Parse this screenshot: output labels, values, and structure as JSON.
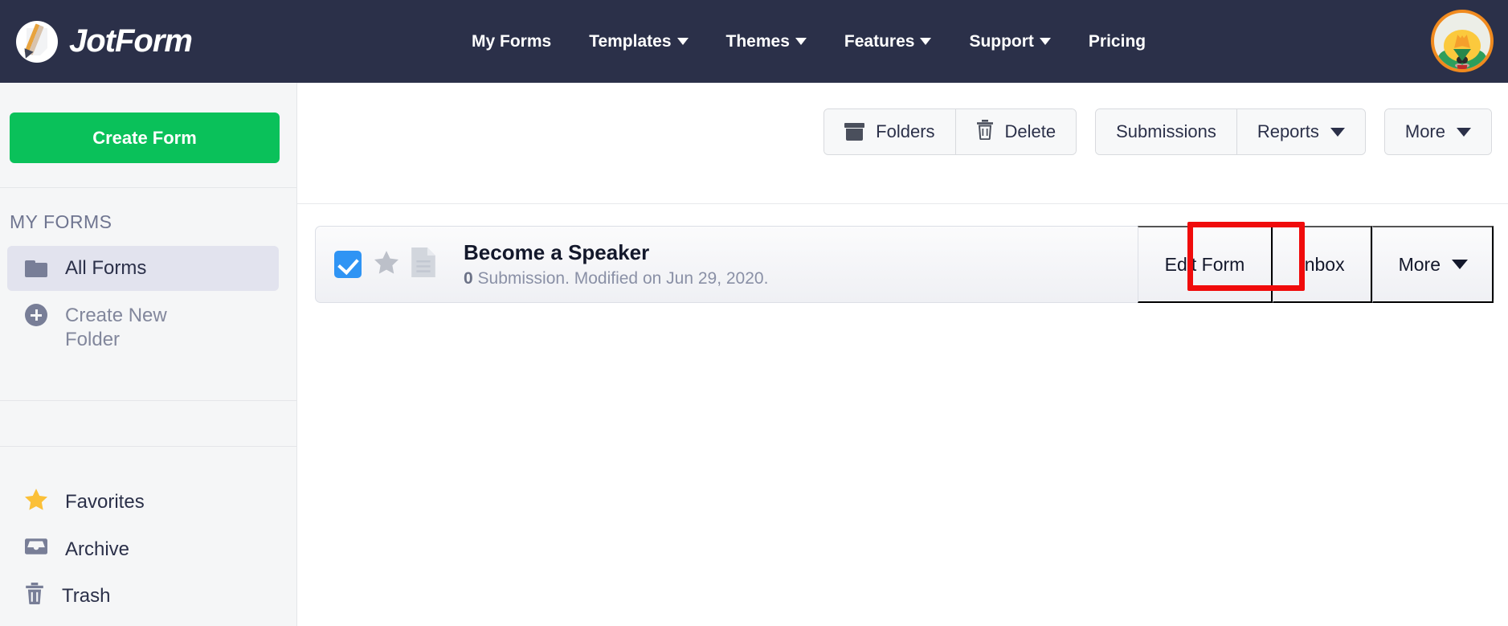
{
  "topnav": {
    "brand": "JotForm",
    "brand_icon": "jotform-pencil-logo",
    "links": [
      {
        "label": "My Forms",
        "has_caret": false
      },
      {
        "label": "Templates",
        "has_caret": true
      },
      {
        "label": "Themes",
        "has_caret": true
      },
      {
        "label": "Features",
        "has_caret": true
      },
      {
        "label": "Support",
        "has_caret": true
      },
      {
        "label": "Pricing",
        "has_caret": false
      }
    ],
    "avatar_icon": "cat-avatar"
  },
  "sidebar": {
    "create_form_label": "Create Form",
    "section_title": "MY FORMS",
    "items": [
      {
        "label": "All Forms",
        "icon": "folder-icon",
        "active": true
      },
      {
        "label": "Create New Folder",
        "icon": "plus-circle-icon",
        "active": false
      }
    ],
    "bottom_items": [
      {
        "label": "Favorites",
        "icon": "star-icon"
      },
      {
        "label": "Archive",
        "icon": "inbox-icon"
      },
      {
        "label": "Trash",
        "icon": "trash-icon"
      }
    ]
  },
  "toolbar": {
    "group_one": [
      {
        "label": "Folders",
        "icon": "archive-box-icon",
        "has_caret": false
      },
      {
        "label": "Delete",
        "icon": "trash-icon",
        "has_caret": false
      }
    ],
    "group_two": [
      {
        "label": "Submissions",
        "icon": "",
        "has_caret": false
      },
      {
        "label": "Reports",
        "icon": "",
        "has_caret": true
      }
    ],
    "group_three": [
      {
        "label": "More",
        "icon": "",
        "has_caret": true
      }
    ]
  },
  "forms": [
    {
      "title": "Become a Speaker",
      "submission_count": "0",
      "submission_text": " Submission. Modified on Jun 29, 2020.",
      "checked": true,
      "starred": false,
      "actions": [
        {
          "label": "Edit Form",
          "has_caret": false,
          "highlighted": true
        },
        {
          "label": "Inbox",
          "has_caret": false,
          "highlighted": false
        },
        {
          "label": "More",
          "has_caret": true,
          "highlighted": false
        }
      ]
    }
  ],
  "colors": {
    "navbar_bg": "#2b3049",
    "create_form_green": "#0ac15a",
    "checkbox_blue": "#2f94f4",
    "highlight_red": "#f00b0b",
    "star_yellow": "#fbc038",
    "avatar_orange": "#f08a1e"
  }
}
